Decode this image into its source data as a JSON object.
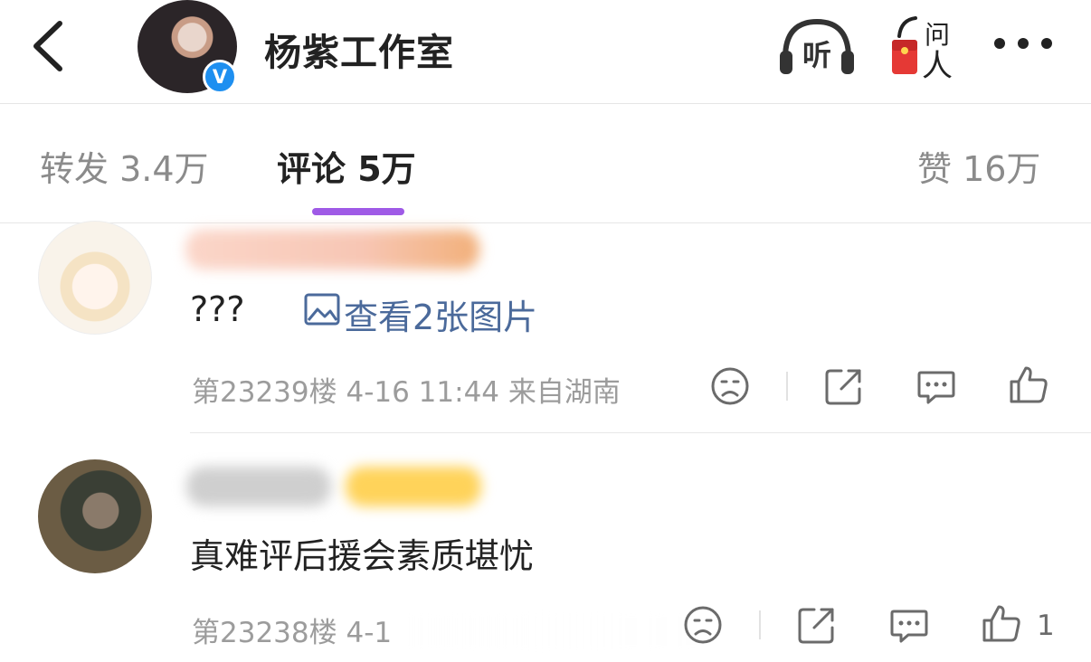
{
  "header": {
    "account_name": "杨紫工作室",
    "verified_badge": "V",
    "icons": [
      "back-icon",
      "listen-icon",
      "ask-red-envelope-icon",
      "more-icon"
    ],
    "listen_label": "听",
    "ask_label_top": "问",
    "ask_label_bottom": "人"
  },
  "tabs": {
    "repost": "转发 3.4万",
    "comments": "评论 5万",
    "likes": "赞 16万",
    "active": "comments",
    "accent_color": "#9f5ae6"
  },
  "comments": [
    {
      "text": "???",
      "image_link": "查看2张图片",
      "meta": "第23239楼  4-16 11:44  来自湖南",
      "likes": ""
    },
    {
      "text": "真难评后援会素质堪忧",
      "meta": "第23238楼  4-1",
      "likes": "1"
    }
  ]
}
